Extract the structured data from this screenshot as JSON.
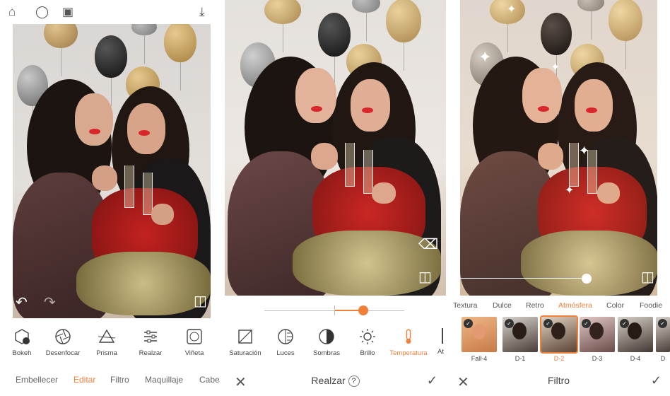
{
  "panel1": {
    "tools": [
      {
        "label": "Bokeh",
        "icon": "bokeh-icon"
      },
      {
        "label": "Desenfocar",
        "icon": "aperture-icon"
      },
      {
        "label": "Prisma",
        "icon": "prism-icon"
      },
      {
        "label": "Realzar",
        "icon": "sliders-icon"
      },
      {
        "label": "Viñeta",
        "icon": "vignette-icon"
      }
    ],
    "tabs": [
      "Embellecer",
      "Editar",
      "Filtro",
      "Maquillaje",
      "Cabe"
    ],
    "active_tab": "Editar"
  },
  "panel2": {
    "tools": [
      {
        "label": "Saturación",
        "icon": "saturation-icon"
      },
      {
        "label": "Luces",
        "icon": "highlights-icon"
      },
      {
        "label": "Sombras",
        "icon": "shadows-icon"
      },
      {
        "label": "Brillo",
        "icon": "brightness-icon"
      },
      {
        "label": "Temperatura",
        "icon": "thermometer-icon"
      },
      {
        "label": "At",
        "icon": "atmosphere-icon"
      }
    ],
    "active_tool": "Temperatura",
    "title": "Realzar",
    "slider_value": 0.75
  },
  "panel3": {
    "categories": [
      "Textura",
      "Dulce",
      "Retro",
      "Atmósfera",
      "Color",
      "Foodie"
    ],
    "active_category": "Atmósfera",
    "filters": [
      "Fall-4",
      "D-1",
      "D-2",
      "D-3",
      "D-4",
      "D"
    ],
    "selected_filter": "D-2",
    "title": "Filtro",
    "slider_value": 0.95
  },
  "colors": {
    "accent": "#f07f3a"
  }
}
